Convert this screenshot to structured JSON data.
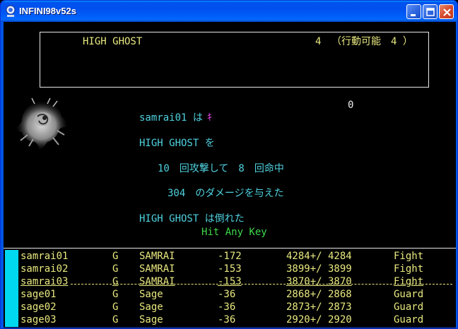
{
  "window": {
    "title": "INFINI98v52s",
    "buttons": [
      "minimize",
      "maximize",
      "close"
    ]
  },
  "enemy": {
    "name": "HIGH GHOST",
    "count": "4",
    "actionable": "（行動可能　4 ）"
  },
  "counter": "0",
  "battle_log": {
    "line1_name": "samrai01 は",
    "line1_mark": "ｷ",
    "line2": "HIGH GHOST を",
    "line3": "10　回攻撃して　8　回命中",
    "line4": "304　のダメージを与えた",
    "line5": "HIGH GHOST は倒れた",
    "prompt": "Hit Any Key"
  },
  "party": [
    {
      "name": "samrai01",
      "align": "G",
      "class": "SAMRAI",
      "ac": "-172",
      "hp": "4284+/ 4284",
      "status": "Fight"
    },
    {
      "name": "samrai02",
      "align": "G",
      "class": "SAMRAI",
      "ac": "-153",
      "hp": "3899+/ 3899",
      "status": "Fight"
    },
    {
      "name": "samrai03",
      "align": "G",
      "class": "SAMRAI",
      "ac": "-153",
      "hp": "3870+/ 3870",
      "status": "Fight"
    },
    {
      "name": "sage01",
      "align": "G",
      "class": "Sage",
      "ac": "-36",
      "hp": "2868+/ 2868",
      "status": "Guard"
    },
    {
      "name": "sage02",
      "align": "G",
      "class": "Sage",
      "ac": "-36",
      "hp": "2873+/ 2873",
      "status": "Guard"
    },
    {
      "name": "sage03",
      "align": "G",
      "class": "Sage",
      "ac": "-36",
      "hp": "2920+/ 2920",
      "status": "Guard"
    }
  ],
  "colors": {
    "yellow_text": "#e8e880",
    "cyan_text": "#4fd2e0",
    "green_text": "#3ed84a",
    "party_bar": "#00d8f0"
  }
}
